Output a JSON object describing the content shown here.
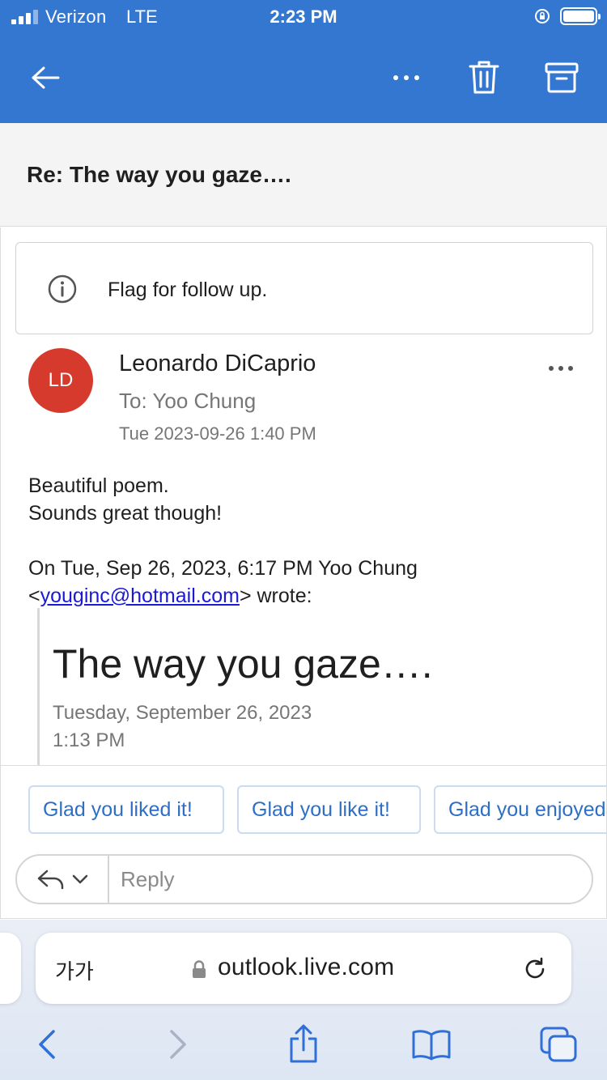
{
  "status_bar": {
    "carrier": "Verizon",
    "network": "LTE",
    "time": "2:23 PM",
    "battery_level": 1.0
  },
  "header": {
    "icons": [
      "back-arrow-icon",
      "more-icon",
      "trash-icon",
      "archive-icon"
    ],
    "color": "#3477d0"
  },
  "subject": "Re: The way you gaze….",
  "flag": {
    "text": "Flag for follow up.",
    "icon": "info-icon"
  },
  "message": {
    "avatar_initials": "LD",
    "avatar_color": "#d63a2c",
    "sender": "Leonardo DiCaprio",
    "to": "To: Yoo Chung",
    "date": "Tue 2023-09-26 1:40 PM",
    "body_line1": "Beautiful poem.",
    "body_line2": "Sounds great though!",
    "quote_intro": "On Tue, Sep 26, 2023, 6:17 PM Yoo Chung",
    "quote_lt": "<",
    "quote_email": "youginc@hotmail.com",
    "quote_gt_wrote": "> wrote:",
    "quoted_title": "The way you gaze….",
    "quoted_date": "Tuesday, September 26, 2023",
    "quoted_time": "1:13 PM"
  },
  "quick_replies": [
    "Glad you liked it!",
    "Glad you like it!",
    "Glad you enjoyed it!"
  ],
  "reply_placeholder": "Reply",
  "browser": {
    "text_size_label": "가가",
    "url": "outlook.live.com",
    "toolbar_icons": [
      "back-icon",
      "forward-icon",
      "share-icon",
      "bookmarks-icon",
      "tabs-icon"
    ]
  }
}
